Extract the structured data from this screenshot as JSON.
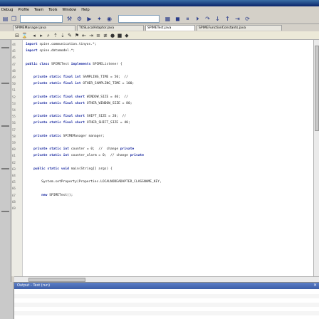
{
  "menu": {
    "items": [
      "Debug",
      "Profile",
      "Team",
      "Tools",
      "Window",
      "Help"
    ]
  },
  "toolbar": {
    "run_icon": "run-icon",
    "debug_icon": "debug-icon",
    "combo_value": ""
  },
  "tabs": [
    {
      "label": "SPIMEManager.java"
    },
    {
      "label": "TOSLocalAdaptor.java"
    },
    {
      "label": "SPIMETest.java"
    },
    {
      "label": "SPIMEFunctionConstants.java"
    }
  ],
  "editor": {
    "line_numbers": [
      "44",
      "45",
      "46",
      "47",
      "48",
      "49",
      "50",
      "51",
      "52",
      "53",
      "54",
      "55",
      "56",
      "57",
      "58",
      "59",
      "60",
      "61",
      "62",
      "63",
      "64",
      "65",
      "66",
      "67",
      "68",
      "69"
    ],
    "lines": [
      {
        "ln": "44",
        "text": "import spine.communication.tinyos.*;"
      },
      {
        "ln": "45",
        "text": "import spine.datamodel.*;"
      },
      {
        "ln": "46",
        "text": ""
      },
      {
        "ln": "47",
        "text": "public class SPIMETest implements SPIMEListener {"
      },
      {
        "ln": "48",
        "text": ""
      },
      {
        "ln": "49",
        "text": "    private static final int SAMPLING_TIME = 50;  //"
      },
      {
        "ln": "50",
        "text": "    private static final int OTHER_SAMPLING_TIME = 100;"
      },
      {
        "ln": "51",
        "text": ""
      },
      {
        "ln": "52",
        "text": "    private static final short WINDOW_SIZE = 40;  //"
      },
      {
        "ln": "53",
        "text": "    private static final short OTHER_WINDOW_SIZE = 80;"
      },
      {
        "ln": "54",
        "text": ""
      },
      {
        "ln": "55",
        "text": "    private static final short SHIFT_SIZE = 20;  //"
      },
      {
        "ln": "56",
        "text": "    private static final short OTHER_SHIFT_SIZE = 40;"
      },
      {
        "ln": "57",
        "text": ""
      },
      {
        "ln": "58",
        "text": "    private static SPIMEManager manager;"
      },
      {
        "ln": "59",
        "text": ""
      },
      {
        "ln": "60",
        "text": "    private static int counter = 0;  //  change private"
      },
      {
        "ln": "61",
        "text": "    private static int counter_alarm = 0;  // change private"
      },
      {
        "ln": "62",
        "text": ""
      },
      {
        "ln": "63",
        "text": "    public static void main(String[] args) {"
      },
      {
        "ln": "64",
        "text": ""
      },
      {
        "ln": "65",
        "text": "        System.setProperty(Properties.LOCALNODEADAPTER_CLASSNAME_KEY,"
      },
      {
        "ln": "66",
        "text": ""
      },
      {
        "ln": "67",
        "text": "        new SPIMETest();"
      },
      {
        "ln": "68",
        "text": ""
      },
      {
        "ln": "69",
        "text": ""
      }
    ]
  },
  "output": {
    "title": "Output - Test (run)"
  },
  "colors": {
    "titlebar": "#0a246a",
    "output_bar": "#3c5ea6",
    "keyword": "#1a2aa0"
  }
}
